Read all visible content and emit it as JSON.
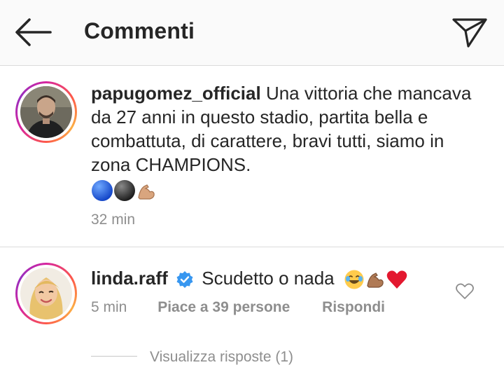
{
  "header": {
    "back_icon": "arrow-left-icon",
    "title": "Commenti",
    "share_icon": "paper-plane-icon"
  },
  "post": {
    "username": "papugomez_official",
    "text": "Una vittoria che mancava da 27 anni in questo stadio, partita bella e combattuta, di carattere, bravi tutti, siamo in zona CHAMPIONS.",
    "emojis": [
      "blue-circle-emoji",
      "black-circle-emoji",
      "flexed-biceps-emoji"
    ],
    "time": "32 min"
  },
  "comment": {
    "username": "linda.raff",
    "verified_icon": "verified-badge-icon",
    "text": "Scudetto o nada",
    "emojis": [
      "joy-emoji",
      "flexed-biceps-emoji",
      "red-heart-emoji"
    ],
    "time": "5 min",
    "likes": "Piace a 39 persone",
    "reply": "Rispondi",
    "like_icon": "heart-outline-icon",
    "view_replies": "Visualizza risposte (1)"
  },
  "colors": {
    "text": "#262626",
    "secondary": "#8e8e8e",
    "verified": "#3897f0",
    "divider": "#dbdbdb"
  }
}
